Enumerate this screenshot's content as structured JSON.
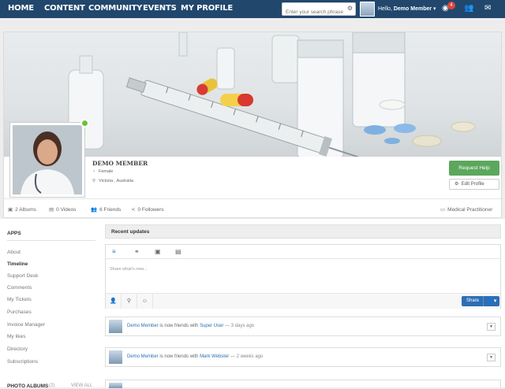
{
  "nav": {
    "items": [
      "HOME",
      "CONTENT",
      "COMMUNITY",
      "EVENTS",
      "MY PROFILE"
    ],
    "search_placeholder": "Enter your search phrase",
    "hello_prefix": "Hello,",
    "user_name": "Demo Member",
    "notification_count": "4"
  },
  "profile": {
    "name": "DEMO MEMBER",
    "gender": "Female",
    "location": "Victoria , Australia",
    "request_help_label": "Request Help",
    "edit_profile_label": "Edit Profile",
    "stats": {
      "albums": "2 Albums",
      "videos": "0 Videos",
      "friends": "6 Friends",
      "followers": "0 Followers",
      "profile_type": "Medical Practitioner"
    }
  },
  "apps": {
    "title": "APPS",
    "items": [
      "About",
      "Timeline",
      "Support Desk",
      "Comments",
      "My Tickets",
      "Purchases",
      "Invoice Manager",
      "My likes",
      "Directory",
      "Subscriptions"
    ],
    "active": "Timeline",
    "photo_albums_title": "PHOTO ALBUMS",
    "photo_albums_count": "(2)",
    "view_all": "VIEW ALL"
  },
  "stream": {
    "header": "Recent updates",
    "composer_placeholder": "Share what's new...",
    "share_label": "Share",
    "activities": [
      {
        "actor": "Demo Member",
        "verb": "is now friends with",
        "target": "Super User",
        "time": "— 3 days ago"
      },
      {
        "actor": "Demo Member",
        "verb": "is now friends with",
        "target": "Mark Webster",
        "time": "— 2 weeks ago"
      }
    ]
  },
  "colors": {
    "navbar": "#21476d",
    "request_help": "#5ba75c",
    "share": "#2d6fb4",
    "badge": "#e0443a",
    "online": "#6dc13c"
  }
}
